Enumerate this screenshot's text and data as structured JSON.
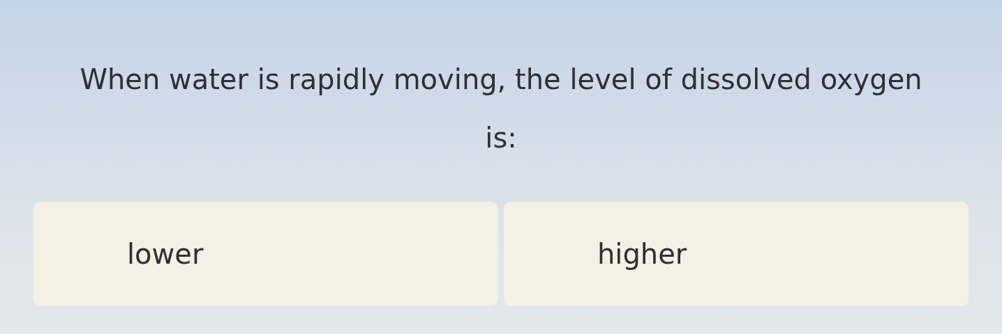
{
  "question": "When water is rapidly moving, the level of dissolved oxygen is:",
  "options": [
    {
      "label": "lower",
      "selected": false
    },
    {
      "label": "higher",
      "selected": false
    }
  ]
}
